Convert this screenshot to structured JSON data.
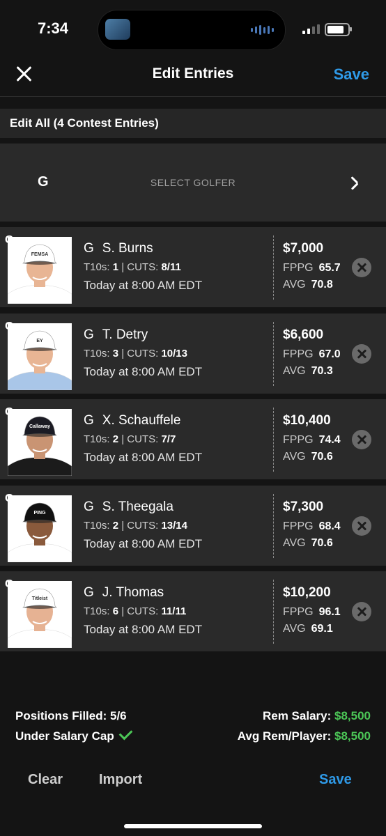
{
  "status_bar": {
    "time": "7:34"
  },
  "header": {
    "title": "Edit Entries",
    "save_label": "Save"
  },
  "edit_all": {
    "label": "Edit All (4 Contest Entries)"
  },
  "empty_slot": {
    "position": "G",
    "label": "SELECT GOLFER"
  },
  "players": [
    {
      "pos": "G",
      "slot": "G",
      "name": "S. Burns",
      "t10s_label": "T10s:",
      "t10s": "1",
      "cuts_label": "CUTS:",
      "cuts": "8/11",
      "time": "Today at 8:00 AM EDT",
      "salary": "$7,000",
      "fppg_label": "FPPG",
      "fppg": "65.7",
      "avg_label": "AVG",
      "avg": "70.8",
      "cap_text": "FEMSA",
      "cap_color": "#ffffff",
      "shirt_color": "#ffffff",
      "skin": "#e8b594"
    },
    {
      "pos": "G",
      "slot": "G",
      "name": "T. Detry",
      "t10s_label": "T10s:",
      "t10s": "3",
      "cuts_label": "CUTS:",
      "cuts": "10/13",
      "time": "Today at 8:00 AM EDT",
      "salary": "$6,600",
      "fppg_label": "FPPG",
      "fppg": "67.0",
      "avg_label": "AVG",
      "avg": "70.3",
      "cap_text": "EY",
      "cap_color": "#ffffff",
      "shirt_color": "#a9c6e8",
      "skin": "#e8b594"
    },
    {
      "pos": "G",
      "slot": "G",
      "name": "X. Schauffele",
      "t10s_label": "T10s:",
      "t10s": "2",
      "cuts_label": "CUTS:",
      "cuts": "7/7",
      "time": "Today at 8:00 AM EDT",
      "salary": "$10,400",
      "fppg_label": "FPPG",
      "fppg": "74.4",
      "avg_label": "AVG",
      "avg": "70.6",
      "cap_text": "Callaway",
      "cap_color": "#1b1b24",
      "shirt_color": "#1b1b1b",
      "skin": "#c99473"
    },
    {
      "pos": "G",
      "slot": "G",
      "name": "S. Theegala",
      "t10s_label": "T10s:",
      "t10s": "2",
      "cuts_label": "CUTS:",
      "cuts": "13/14",
      "time": "Today at 8:00 AM EDT",
      "salary": "$7,300",
      "fppg_label": "FPPG",
      "fppg": "68.4",
      "avg_label": "AVG",
      "avg": "70.6",
      "cap_text": "PING",
      "cap_color": "#111111",
      "shirt_color": "#ffffff",
      "skin": "#8a5a3c"
    },
    {
      "pos": "G",
      "slot": "G",
      "name": "J. Thomas",
      "t10s_label": "T10s:",
      "t10s": "6",
      "cuts_label": "CUTS:",
      "cuts": "11/11",
      "time": "Today at 8:00 AM EDT",
      "salary": "$10,200",
      "fppg_label": "FPPG",
      "fppg": "96.1",
      "avg_label": "AVG",
      "avg": "69.1",
      "cap_text": "Titleist",
      "cap_color": "#ffffff",
      "shirt_color": "#ffffff",
      "skin": "#e6b293"
    }
  ],
  "footer": {
    "positions_filled": "Positions Filled: 5/6",
    "under_cap": "Under Salary Cap",
    "rem_salary_label": "Rem Salary:",
    "rem_salary": "$8,500",
    "avg_rem_label": "Avg Rem/Player:",
    "avg_rem": "$8,500"
  },
  "bottom": {
    "clear_label": "Clear",
    "import_label": "Import",
    "save_label": "Save"
  }
}
